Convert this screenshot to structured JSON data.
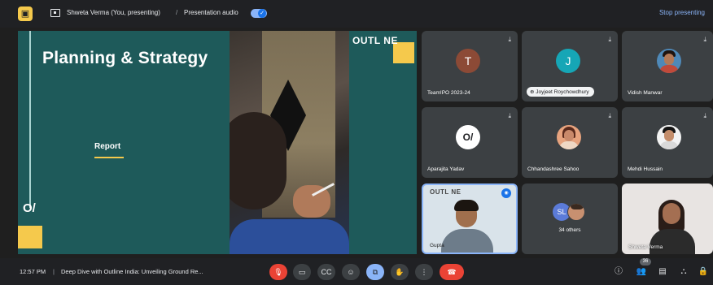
{
  "topbar": {
    "presenter": "Shweta Verma (You, presenting)",
    "separator": "/",
    "audio_label": "Presentation audio",
    "stop_label": "Stop presenting"
  },
  "presentation": {
    "title": "Planning & Strategy",
    "subtitle": "Report",
    "logo_text": "O/",
    "outline_text": "OUTL NE",
    "accent_color": "#f5c94c",
    "background_color": "#1e5a5a"
  },
  "participants": [
    {
      "name": "Team!PO 2023-24",
      "avatar": "T",
      "avatar_color": "#8c4a36"
    },
    {
      "name": "Joyjeet Roychowdhury",
      "avatar": "J",
      "avatar_color": "#16a6b6"
    },
    {
      "name": "Vidish Manwar",
      "avatar": "photo"
    },
    {
      "name": "Aparajita Yadav",
      "avatar": "O/"
    },
    {
      "name": "Chhandashree Sahoo",
      "avatar": "photo"
    },
    {
      "name": "Mehdi Hussain",
      "avatar": "photo"
    },
    {
      "name": "Gupta",
      "avatar": "video",
      "overlay_text": "OUTL NE"
    },
    {
      "name": "34 others",
      "avatar": "SL"
    },
    {
      "name": "Shweta Verma",
      "avatar": "video"
    }
  ],
  "bottombar": {
    "time": "12:57 PM",
    "separator": "|",
    "meeting_title": "Deep Dive with Outline India: Unveiling Ground Re...",
    "participant_count": "36"
  },
  "controls": {
    "mic_icon": "mic-off-icon",
    "camera_icon": "camera-icon",
    "captions_icon": "captions-icon",
    "emoji_icon": "emoji-icon",
    "present_icon": "present-icon",
    "raise_hand_icon": "raise-hand-icon",
    "more_icon": "more-icon",
    "hangup_icon": "hangup-icon"
  }
}
